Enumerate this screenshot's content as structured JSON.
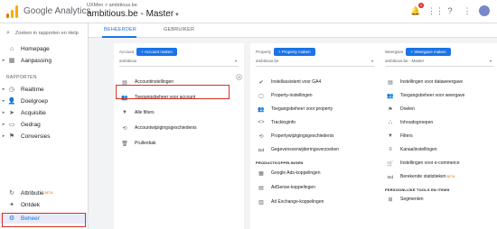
{
  "app": {
    "name": "Google Analytics",
    "breadcrumb": "UXMen > ambitious.be",
    "property_title": "ambitious.be - Master",
    "notification_count": "1"
  },
  "sidebar": {
    "search_placeholder": "Zoeken in rapporten en Help",
    "items_top": [
      {
        "label": "Homepage",
        "icon": "home-icon"
      },
      {
        "label": "Aanpassing",
        "icon": "grid-icon"
      }
    ],
    "section_label": "RAPPORTEN",
    "report_items": [
      {
        "label": "Realtime",
        "icon": "clock-icon"
      },
      {
        "label": "Doelgroep",
        "icon": "person-icon"
      },
      {
        "label": "Acquisitie",
        "icon": "acquisition-icon"
      },
      {
        "label": "Gedrag",
        "icon": "behavior-icon"
      },
      {
        "label": "Conversies",
        "icon": "flag-icon"
      }
    ],
    "bottom_items": [
      {
        "label": "Attributie",
        "badge": "BETA",
        "icon": "attribution-icon"
      },
      {
        "label": "Ontdek",
        "icon": "lightbulb-icon"
      },
      {
        "label": "Beheer",
        "icon": "gear-icon"
      }
    ]
  },
  "tabs": [
    "BEHEERDER",
    "GEBRUIKER"
  ],
  "columns": [
    {
      "label": "Account",
      "button": "+ Account maken",
      "selector": "ambitious",
      "items": [
        {
          "label": "Accountinstellingen",
          "icon": "building-icon"
        },
        {
          "label": "Toegangsbeheer voor account",
          "icon": "people-icon"
        },
        {
          "label": "Alle filters",
          "icon": "filter-icon"
        },
        {
          "label": "Accountwijzigingsgeschiedenis",
          "icon": "history-icon"
        },
        {
          "label": "Prullenbak",
          "icon": "trash-icon"
        }
      ]
    },
    {
      "label": "Property",
      "button": "+ Property maken",
      "selector": "ambitious.be",
      "items": [
        {
          "label": "Instellassistent voor GA4",
          "icon": "check-icon"
        },
        {
          "label": "Property-instellingen",
          "icon": "window-icon"
        },
        {
          "label": "Toegangsbeheer voor property",
          "icon": "people-icon"
        },
        {
          "label": "Trackinginfo",
          "icon": "code-icon"
        },
        {
          "label": "Propertywijzigingsgeschiedenis",
          "icon": "history-icon"
        },
        {
          "label": "Gegevensverwijderingsverzoeken",
          "icon": "dd-icon",
          "badge": "Dd"
        }
      ],
      "section": "PRODUCTKOPPELINGEN",
      "section_items": [
        {
          "label": "Google Ads-koppelingen",
          "icon": "ads-icon"
        },
        {
          "label": "AdSense-koppelingen",
          "icon": "adsense-icon"
        },
        {
          "label": "Ad Exchange-koppelingen",
          "icon": "adexchange-icon"
        }
      ]
    },
    {
      "label": "Weergave",
      "button": "+ Weergave maken",
      "selector": "ambitious.be - Master",
      "items": [
        {
          "label": "Instellingen voor dataweergave",
          "icon": "doc-icon"
        },
        {
          "label": "Toegangsbeheer voor weergave",
          "icon": "people-icon"
        },
        {
          "label": "Doelen",
          "icon": "flag-icon"
        },
        {
          "label": "Inhoudsgroepen",
          "icon": "group-icon"
        },
        {
          "label": "Filters",
          "icon": "filter-icon"
        },
        {
          "label": "Kanaalinstellingen",
          "icon": "channel-icon"
        },
        {
          "label": "Instellingen voor e-commerce",
          "icon": "cart-icon"
        },
        {
          "label": "Berekende statistieken",
          "icon": "dd-icon",
          "badge": "Dd",
          "tag": "BETA"
        }
      ],
      "section": "PERSOONLIJKE TOOLS EN ITEMS",
      "section_items": [
        {
          "label": "Segmenten",
          "icon": "segment-icon"
        }
      ]
    }
  ],
  "colors": {
    "accent": "#1a73e8",
    "highlight": "#d93025",
    "beta": "#e37400"
  }
}
